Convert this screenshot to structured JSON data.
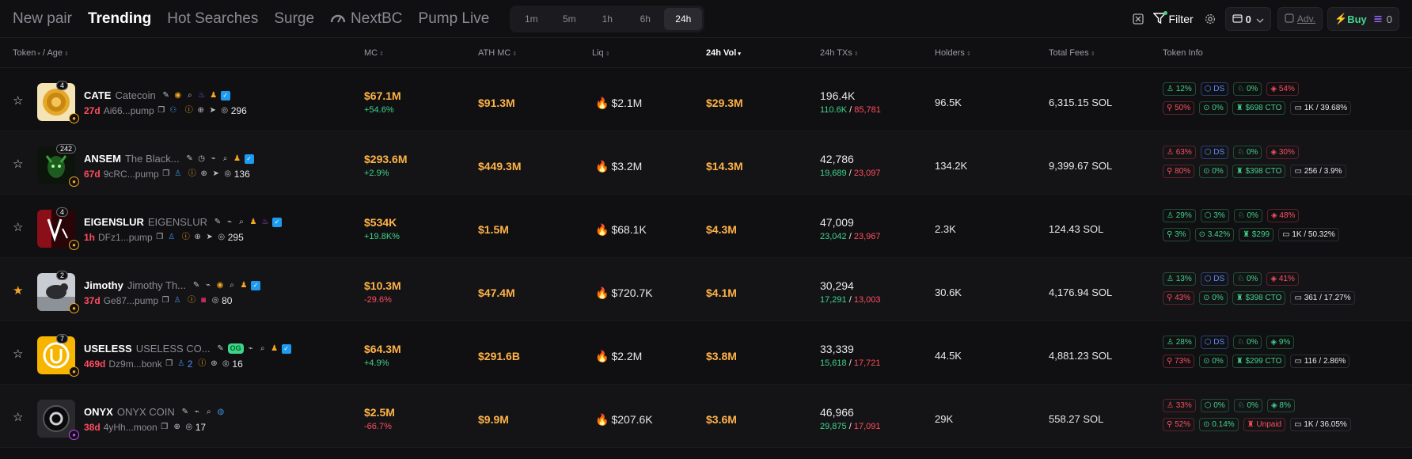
{
  "nav": {
    "items": [
      "New pair",
      "Trending",
      "Hot Searches",
      "Surge",
      "NextBC",
      "Pump Live"
    ],
    "timeframes": [
      "1m",
      "5m",
      "1h",
      "6h",
      "24h"
    ]
  },
  "toolbar": {
    "filter_label": "Filter",
    "wallet_count": "0",
    "adv_label": "Adv.",
    "buy_label": "Buy",
    "sol_amount": "0"
  },
  "columns": {
    "token": "Token",
    "age": "Age",
    "mc": "MC",
    "ath_mc": "ATH MC",
    "liq": "Liq",
    "vol": "24h Vol",
    "txs": "24h TXs",
    "holders": "Holders",
    "fees": "Total Fees",
    "info": "Token Info"
  },
  "rows": [
    {
      "rank": "4",
      "symbol": "CATE",
      "name": "Catecoin",
      "age": "27d",
      "address": "Ai66...pump",
      "views": "296",
      "mc": "$67.1M",
      "mc_change": "+54.6%",
      "ath": "$91.3M",
      "liq": "$2.1M",
      "vol": "$29.3M",
      "txs": "196.4K",
      "buys": "110.6K",
      "sells": "85,781",
      "holders": "96.5K",
      "fees": "6,315.15 SOL",
      "t1": "12%",
      "t2": "DS",
      "t3": "0%",
      "t4": "54%",
      "t5": "50%",
      "t6": "0%",
      "t7": "$698 CTO",
      "t8": "1K / 39.68%"
    },
    {
      "rank": "242",
      "symbol": "ANSEM",
      "name": "The Black...",
      "age": "67d",
      "address": "9cRC...pump",
      "views": "136",
      "mc": "$293.6M",
      "mc_change": "+2.9%",
      "ath": "$449.3M",
      "liq": "$3.2M",
      "vol": "$14.3M",
      "txs": "42,786",
      "buys": "19,689",
      "sells": "23,097",
      "holders": "134.2K",
      "fees": "9,399.67 SOL",
      "t1": "63%",
      "t2": "DS",
      "t3": "0%",
      "t4": "30%",
      "t5": "80%",
      "t6": "0%",
      "t7": "$398 CTO",
      "t8": "256 / 3.9%"
    },
    {
      "rank": "4",
      "symbol": "EIGENSLUR",
      "name": "EIGENSLUR",
      "age": "1h",
      "address": "DFz1...pump",
      "views": "295",
      "mc": "$534K",
      "mc_change": "+19.8K%",
      "ath": "$1.5M",
      "liq": "$68.1K",
      "vol": "$4.3M",
      "txs": "47,009",
      "buys": "23,042",
      "sells": "23,967",
      "holders": "2.3K",
      "fees": "124.43 SOL",
      "t1": "29%",
      "t2": "3%",
      "t3": "0%",
      "t4": "48%",
      "t5": "3%",
      "t6": "3.42%",
      "t7": "$299",
      "t8": "1K / 50.32%"
    },
    {
      "rank": "2",
      "symbol": "Jimothy",
      "name": "Jimothy Th...",
      "age": "37d",
      "address": "Ge87...pump",
      "views": "80",
      "mc": "$10.3M",
      "mc_change": "-29.6%",
      "ath": "$47.4M",
      "liq": "$720.7K",
      "vol": "$4.1M",
      "txs": "30,294",
      "buys": "17,291",
      "sells": "13,003",
      "holders": "30.6K",
      "fees": "4,176.94 SOL",
      "t1": "13%",
      "t2": "DS",
      "t3": "0%",
      "t4": "41%",
      "t5": "43%",
      "t6": "0%",
      "t7": "$398 CTO",
      "t8": "361 / 17.27%"
    },
    {
      "rank": "7",
      "symbol": "USELESS",
      "name": "USELESS CO...",
      "og": "OG",
      "age": "469d",
      "address": "Dz9m...bonk",
      "users": "2",
      "views": "16",
      "mc": "$64.3M",
      "mc_change": "+4.9%",
      "ath": "$291.6B",
      "liq": "$2.2M",
      "vol": "$3.8M",
      "txs": "33,339",
      "buys": "15,618",
      "sells": "17,721",
      "holders": "44.5K",
      "fees": "4,881.23 SOL",
      "t1": "28%",
      "t2": "DS",
      "t3": "0%",
      "t4": "9%",
      "t5": "73%",
      "t6": "0%",
      "t7": "$299 CTO",
      "t8": "116 / 2.86%"
    },
    {
      "symbol": "ONYX",
      "name": "ONYX COIN",
      "age": "38d",
      "address": "4yHh...moon",
      "views": "17",
      "mc": "$2.5M",
      "mc_change": "-66.7%",
      "ath": "$9.9M",
      "liq": "$207.6K",
      "vol": "$3.6M",
      "txs": "46,966",
      "buys": "29,875",
      "sells": "17,091",
      "holders": "29K",
      "fees": "558.27 SOL",
      "t1": "33%",
      "t2": "0%",
      "t3": "0%",
      "t4": "8%",
      "t5": "52%",
      "t6": "0.14%",
      "t7": "Unpaid",
      "t8": "1K / 36.05%"
    }
  ]
}
